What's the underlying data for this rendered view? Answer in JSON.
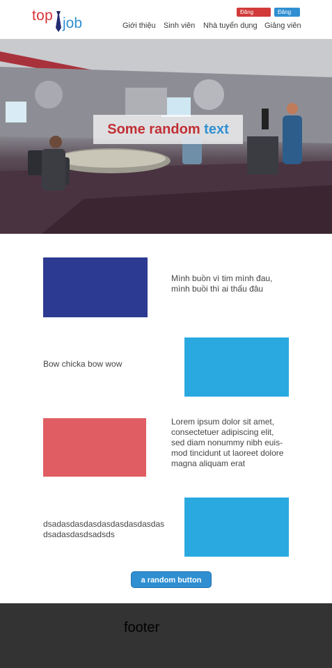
{
  "logo": {
    "part1": "top",
    "part2": "job"
  },
  "auth": {
    "login": "Đăng nhập",
    "register": "Đăng kí"
  },
  "nav": [
    "Giới thiệu",
    "Sinh viên",
    "Nhà tuyển dụng",
    "Giảng viên"
  ],
  "hero": {
    "caption_part1": "Some random",
    "caption_part2": "text"
  },
  "rows": [
    {
      "text": "Mình buồn vì tim mình đau, mình buồi thì ai thấu đâu",
      "color": "#2d3a92"
    },
    {
      "text": "Bow chicka bow wow",
      "color": "#2aa9e0"
    },
    {
      "text": "Lorem ipsum dolor sit amet, consectetuer adipiscing elit, sed diam nonummy nibh euis-mod tincidunt ut laoreet dolore magna aliquam erat",
      "color": "#e05e63"
    },
    {
      "text": "dsadasdasdasdasdasdasdasdas dsadasdasdsadsds",
      "color": "#2aa9e0"
    }
  ],
  "button": {
    "label": "a random button"
  },
  "footer": {
    "label": "footer"
  },
  "colors": {
    "brand_red": "#d23a3a",
    "brand_blue": "#2f8fd1",
    "footer_bg": "#333333"
  }
}
